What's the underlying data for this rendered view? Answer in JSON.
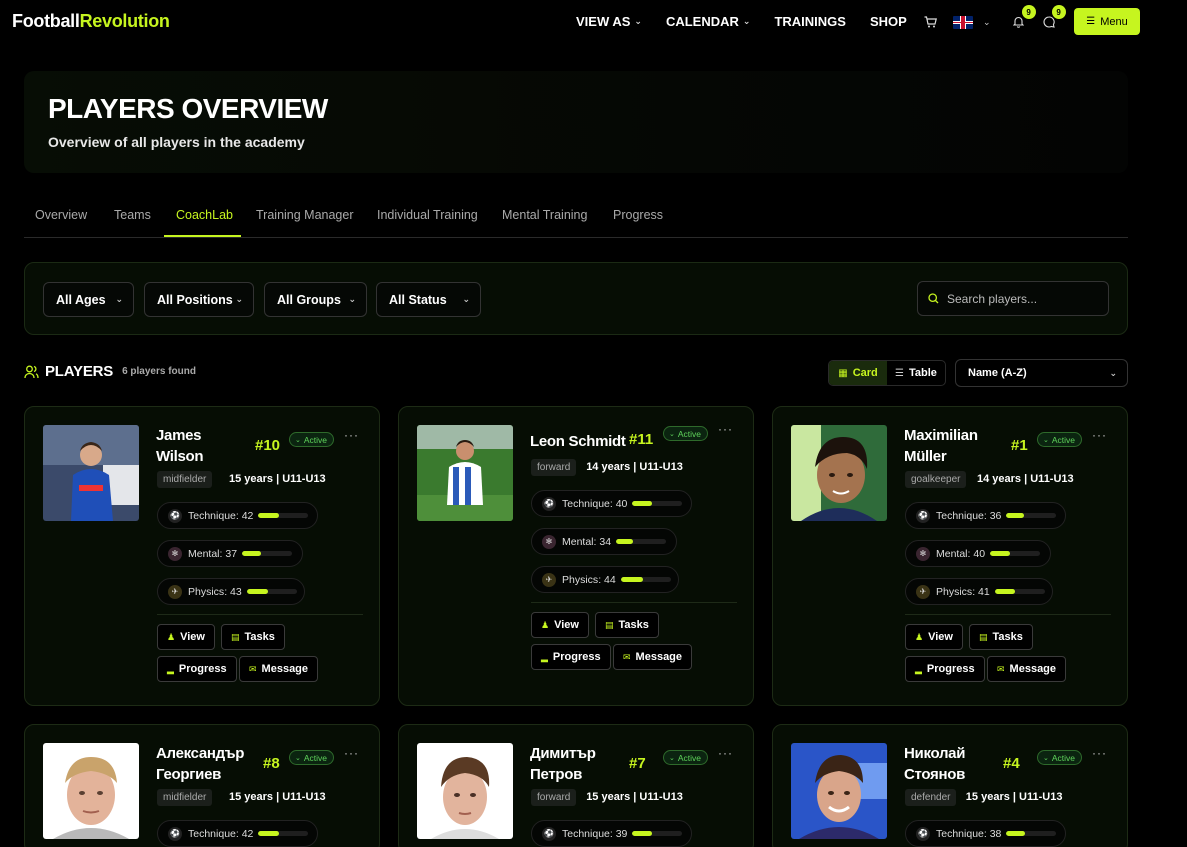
{
  "brand": {
    "part1": "Football",
    "part2": "Revolution",
    "accent": "#c6f51f"
  },
  "nav": {
    "links": [
      {
        "label": "VIEW AS",
        "dropdown": true
      },
      {
        "label": "CALENDAR",
        "dropdown": true
      },
      {
        "label": "TRAININGS",
        "dropdown": false
      },
      {
        "label": "SHOP",
        "dropdown": false
      }
    ],
    "notifications_count": "9",
    "messages_count": "9",
    "menu_label": "Menu"
  },
  "hero": {
    "title": "PLAYERS OVERVIEW",
    "subtitle": "Overview of all players in the academy"
  },
  "tabs": [
    {
      "label": "Overview",
      "active": false
    },
    {
      "label": "Teams",
      "active": false
    },
    {
      "label": "CoachLab",
      "active": true
    },
    {
      "label": "Training Manager",
      "active": false
    },
    {
      "label": "Individual Training",
      "active": false
    },
    {
      "label": "Mental Training",
      "active": false
    },
    {
      "label": "Progress",
      "active": false
    }
  ],
  "filters": {
    "ages": "All Ages",
    "positions": "All Positions",
    "groups": "All Groups",
    "status": "All Status",
    "search_placeholder": "Search players..."
  },
  "players_header": {
    "title": "PLAYERS",
    "count_text": "6 players found"
  },
  "view_toggle": {
    "card": "Card",
    "table": "Table",
    "selected": "card"
  },
  "sort": {
    "selected": "Name (A-Z)"
  },
  "stat_labels": {
    "technique": "Technique",
    "mental": "Mental",
    "physics": "Physics"
  },
  "actions": {
    "view": "View",
    "tasks": "Tasks",
    "progress": "Progress",
    "message": "Message"
  },
  "players": [
    {
      "name_line1": "James",
      "name_line2": "Wilson",
      "number": "#10",
      "status": "Active",
      "position": "midfielder",
      "age_group": "15 years | U11-U13",
      "technique": 42,
      "mental": 37,
      "physics": 43,
      "photo": "blue-kit"
    },
    {
      "name_line1": "Leon Schmidt",
      "name_line2": "",
      "number": "#11",
      "status": "Active",
      "position": "forward",
      "age_group": "14 years | U11-U13",
      "technique": 40,
      "mental": 34,
      "physics": 44,
      "photo": "stripes-kit"
    },
    {
      "name_line1": "Maximilian",
      "name_line2": "Müller",
      "number": "#1",
      "status": "Active",
      "position": "goalkeeper",
      "age_group": "14 years | U11-U13",
      "technique": 36,
      "mental": 40,
      "physics": 41,
      "photo": "portrait-dark"
    },
    {
      "name_line1": "Александър",
      "name_line2": "Георгиев",
      "number": "#8",
      "status": "Active",
      "position": "midfielder",
      "age_group": "15 years | U11-U13",
      "technique": 42,
      "mental": null,
      "physics": null,
      "photo": "portrait-blond"
    },
    {
      "name_line1": "Димитър",
      "name_line2": "Петров",
      "number": "#7",
      "status": "Active",
      "position": "forward",
      "age_group": "15 years | U11-U13",
      "technique": 39,
      "mental": null,
      "physics": null,
      "photo": "portrait-brown"
    },
    {
      "name_line1": "Николай",
      "name_line2": "Стоянов",
      "number": "#4",
      "status": "Active",
      "position": "defender",
      "age_group": "15 years | U11-U13",
      "technique": 38,
      "mental": null,
      "physics": null,
      "photo": "portrait-blue"
    }
  ]
}
